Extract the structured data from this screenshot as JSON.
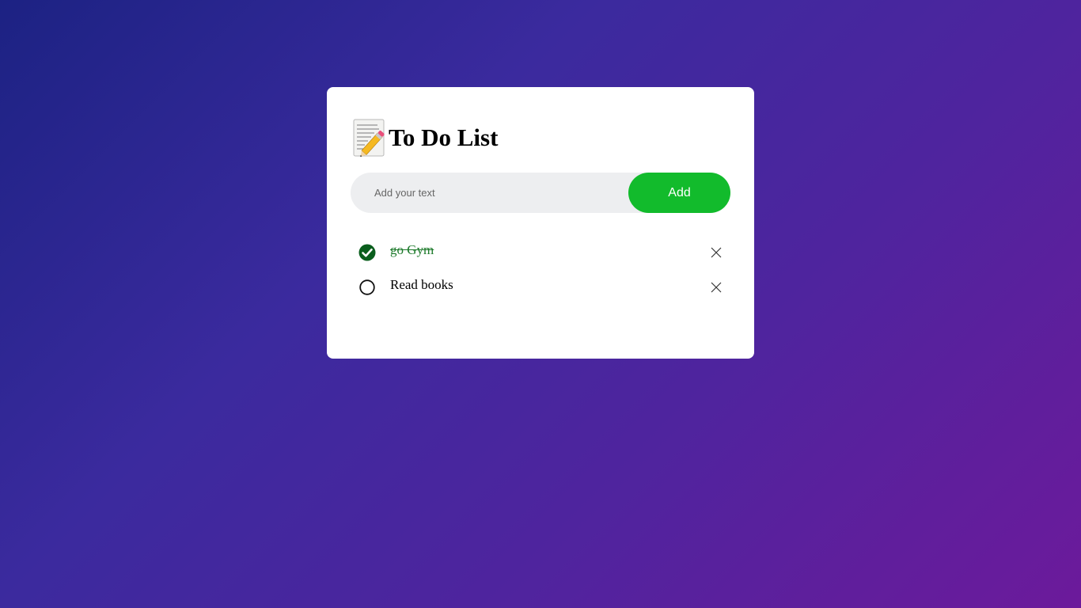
{
  "app": {
    "title": "To Do List",
    "title_icon": "memo-pencil-icon"
  },
  "input": {
    "placeholder": "Add your text",
    "value": ""
  },
  "add_button": {
    "label": "Add",
    "color": "#12bb2c"
  },
  "tasks": [
    {
      "label": "go Gym",
      "done": true,
      "status_icon": "checked-circle-icon",
      "delete_icon": "close-icon"
    },
    {
      "label": "Read books",
      "done": false,
      "status_icon": "unchecked-circle-icon",
      "delete_icon": "close-icon"
    }
  ],
  "colors": {
    "done_text": "#1d7a2b",
    "check_fill": "#0a5e1d",
    "background_start": "#1c2283",
    "background_end": "#6c1a9b"
  }
}
